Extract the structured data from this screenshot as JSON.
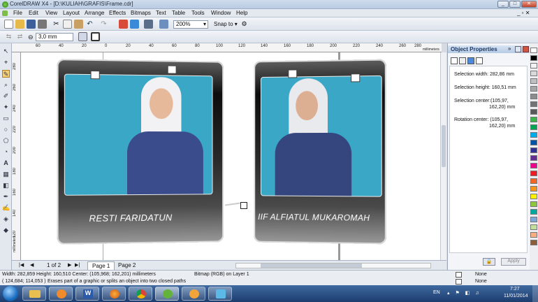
{
  "window": {
    "title": "CorelDRAW X4 - [D:\\KULIAH\\GRAFIS\\Frame.cdr]"
  },
  "menu": [
    "File",
    "Edit",
    "View",
    "Layout",
    "Arrange",
    "Effects",
    "Bitmaps",
    "Text",
    "Table",
    "Tools",
    "Window",
    "Help"
  ],
  "toolbar": {
    "zoom": "200%",
    "snap": "Snap to"
  },
  "propbar": {
    "outline": "3,0 mm"
  },
  "ruler": {
    "h_labels": [
      "60",
      "40",
      "20",
      "0",
      "20",
      "40",
      "60",
      "80",
      "100",
      "120",
      "140",
      "160",
      "180",
      "200",
      "220",
      "240",
      "260",
      "280"
    ],
    "unit": "millimeters",
    "v_labels": [
      "280",
      "260",
      "240",
      "220",
      "200",
      "180",
      "160",
      "140",
      "120",
      "100"
    ],
    "v_unit": "millimeters"
  },
  "canvas": {
    "caption_left": "RESTI FARIDATUN",
    "caption_right": "IIF ALFIATUL MUKAROMAH"
  },
  "pages": {
    "current": "1 of 2",
    "tab1": "Page 1",
    "tab2": "Page 2"
  },
  "panel": {
    "title": "Object Properties",
    "sel_width": "Selection width:  282,86 mm",
    "sel_height": "Selection height: 160,51 mm",
    "sel_center_1": "Selection center:(105,97,",
    "sel_center_2": "162,20) mm",
    "rot_center_1": "Rotation center: (105,97,",
    "rot_center_2": "162,20) mm",
    "apply": "Apply"
  },
  "status": {
    "line1": "Width: 282,859 Height: 160,510 Center: (105,968; 162,201) millimeters",
    "bitmap": "Bitmap (RGB) on Layer 1",
    "coords": "( 124,684; 114,053 )",
    "hint": "Erases part of a graphic or splits an object into two closed paths",
    "fill_none": "None",
    "outline_none": "None"
  },
  "taskbar": {
    "lang": "EN",
    "time": "7:27",
    "date": "11/01/2014"
  },
  "colors": {
    "palette": [
      "#ffffff",
      "#000000",
      "#f2f2f2",
      "#d9d9d9",
      "#bfbfbf",
      "#a6a6a6",
      "#8c8c8c",
      "#737373",
      "#595959",
      "#3ab54a",
      "#00a651",
      "#00aeef",
      "#0054a6",
      "#2e3192",
      "#662d91",
      "#ec008c",
      "#ed1c24",
      "#f26522",
      "#f7941d",
      "#fff200",
      "#8dc63f",
      "#00a99d",
      "#7da7d9",
      "#c4df9b",
      "#f9ad81",
      "#8b5e3c"
    ]
  }
}
